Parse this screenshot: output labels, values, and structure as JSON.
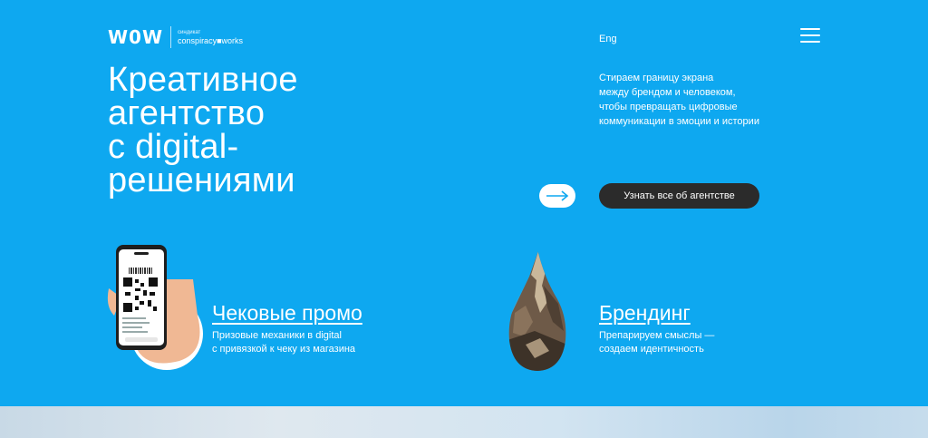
{
  "header": {
    "logo_text": "W0W",
    "logo_sub_small": "синдикат",
    "logo_sub_main": "conspiracy■works",
    "lang_label": "Eng",
    "menu_icon": "hamburger-menu-icon"
  },
  "hero": {
    "headline_lines": [
      "Креативное",
      "агентство",
      "с digital-",
      "решениями"
    ],
    "tagline_lines": [
      "Стираем границу экрана",
      "между брендом и человеком,",
      "чтобы превращать цифровые",
      "коммуникации в эмоции и истории"
    ],
    "arrow_icon": "arrow-right-icon",
    "about_button_label": "Узнать все об агентстве"
  },
  "cards": [
    {
      "title": "Чековые промо",
      "desc_lines": [
        "Призовые механики в digital",
        "с привязкой к чеку из магазина"
      ],
      "image": "phone-qr-receipt-illustration"
    },
    {
      "title": "Брендинг",
      "desc_lines": [
        "Препарируем смыслы —",
        "создаем идентичность"
      ],
      "image": "mountain-peak-illustration"
    }
  ],
  "colors": {
    "background": "#0ea8f0",
    "button_dark": "#2b2b2b",
    "text": "#ffffff"
  }
}
